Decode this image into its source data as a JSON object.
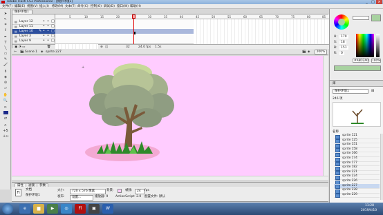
{
  "window": {
    "title": "Adobe Flash CS3 Professional - [保护环境1]"
  },
  "menu": [
    "文件(F)",
    "编辑(E)",
    "视图(V)",
    "插入(I)",
    "修改(M)",
    "文本(T)",
    "命令(C)",
    "控制(O)",
    "调试(D)",
    "窗口(W)",
    "帮助(H)"
  ],
  "document_tab": "保护环境1",
  "timeline": {
    "layers": [
      {
        "name": "Layer 12",
        "selected": false
      },
      {
        "name": "Layer 11",
        "selected": false
      },
      {
        "name": "Layer 10",
        "selected": true
      },
      {
        "name": "Layer 3",
        "selected": false
      },
      {
        "name": "Layer 9",
        "selected": false
      }
    ],
    "frame_numbers": [
      "5",
      "10",
      "15",
      "20",
      "25",
      "30",
      "35",
      "40",
      "45",
      "50",
      "55",
      "60",
      "65",
      "70",
      "75",
      "80",
      "85"
    ],
    "current_frame": "32",
    "frame_rate": "24.0 fps",
    "elapsed": "1.5s"
  },
  "editbar": {
    "scene": "Scene 1",
    "symbol": "sprite 227",
    "zoom": "200%"
  },
  "properties": {
    "tabs": [
      "属性",
      "滤镜",
      "参数"
    ],
    "doc_label": "文档",
    "doc_name": "保护环境1",
    "size_label": "大小:",
    "size_value": "720 x 576 像素",
    "bg_label": "背景:",
    "fps_label": "帧频:",
    "fps_value": "24",
    "fps_unit": "fps",
    "publish_label": "发布:",
    "settings_button": "设置...",
    "player_label": "播放器: 9",
    "as_label": "ActionScript: 2.0",
    "profile_label": "配置文件: 默认"
  },
  "color_panel": {
    "hex": "#A8D2A0",
    "h": "170",
    "s": "18",
    "b": "151",
    "r": "0",
    "g": "0",
    "bb": "0",
    "alpha": "100%"
  },
  "library": {
    "selector": "保护环境1",
    "count": "246 项",
    "column_name": "名称",
    "items": [
      "sprite 121",
      "sprite 125",
      "sprite 151",
      "sprite 158",
      "sprite 166",
      "sprite 174",
      "sprite 177",
      "sprite 182",
      "sprite 221",
      "sprite 224",
      "sprite 226",
      "sprite 227",
      "sprite 228",
      "sprite 229"
    ],
    "selected_item": "sprite 227"
  },
  "taskbar": {
    "time": "11:28",
    "date": "2019/4/10"
  },
  "colors": {
    "stage": "#ffccff",
    "selection": "#2d4f9e",
    "accent": "#e00000"
  }
}
